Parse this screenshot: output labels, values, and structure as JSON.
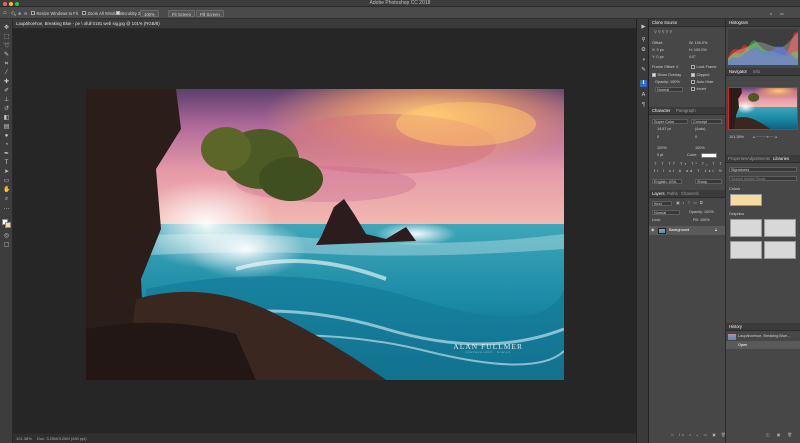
{
  "app_title": "Adobe Photoshop CC 2018",
  "options_bar": {
    "resize_windows": "Resize Windows to Fit",
    "zoom_all_windows": "Zoom All Windows",
    "scrubby_zoom": "Scrubby Zoom",
    "zoom_100": "100%",
    "fit_screen": "Fit Screen",
    "fill_screen": "Fill Screen"
  },
  "document_tab": "Laupāhoehoe, Breaking Blue - pe \\ ofull 0181 web sig.jpg @ 101% (RGB/8)",
  "status_bar": {
    "zoom": "101.38%",
    "doc_size": "Doc: 3.25M/3.25M (280 ppi)"
  },
  "watermark": {
    "name": "ALAN FULLMER",
    "tagline": "PHOTOGRAPHY · HAWAII"
  },
  "clone_source": {
    "title": "Clone Source",
    "offset_label": "Offset:",
    "w_label": "W: 100.0%",
    "h_label": "H: 100.0%",
    "x_label": "X: 0 px",
    "y_label": "Y: 0 px",
    "angle": "0.0°",
    "frame_offset": "Frame Offset: 0",
    "lock_frame": "Lock Frame",
    "show_overlay": "Show Overlay",
    "clipped": "Clipped",
    "opacity": "Opacity: 100%",
    "auto_hide": "Auto Hide",
    "blend": "Normal",
    "invert": "Invert"
  },
  "character": {
    "tab1": "Character",
    "tab2": "Paragraph",
    "font": "Super Color",
    "style": "Concept",
    "size": "14.67 pt",
    "leading": "(Auto)",
    "kerning": "0",
    "tracking": "0",
    "vscale": "100%",
    "hscale": "100%",
    "baseline": "0 pt",
    "color_label": "Color:",
    "language": "English: USA",
    "aa": "Sharp"
  },
  "layers": {
    "tab1": "Layers",
    "tab2": "Paths",
    "tab3": "Channels",
    "kind": "Kind",
    "blend": "Normal",
    "opacity": "Opacity: 100%",
    "lock": "Lock:",
    "fill": "Fill: 100%",
    "layer_name": "Background"
  },
  "histogram": {
    "title": "Histogram"
  },
  "navigator": {
    "tab1": "Navigator",
    "tab2": "Info",
    "zoom": "101.38%"
  },
  "properties": {
    "tab1": "Properties",
    "tab2": "Adjustments",
    "tab3": "Libraries",
    "library": "Signatures",
    "search_placeholder": "Search Adobe Stock",
    "group_colors": "Colors",
    "group_graphics": "Graphics"
  },
  "history": {
    "title": "History",
    "item1": "Laupāhoehoe, Breaking Blue...",
    "item2": "Open"
  },
  "colors": {
    "accent": "#2d6fc6",
    "library_swatch": "#f5dca0"
  }
}
